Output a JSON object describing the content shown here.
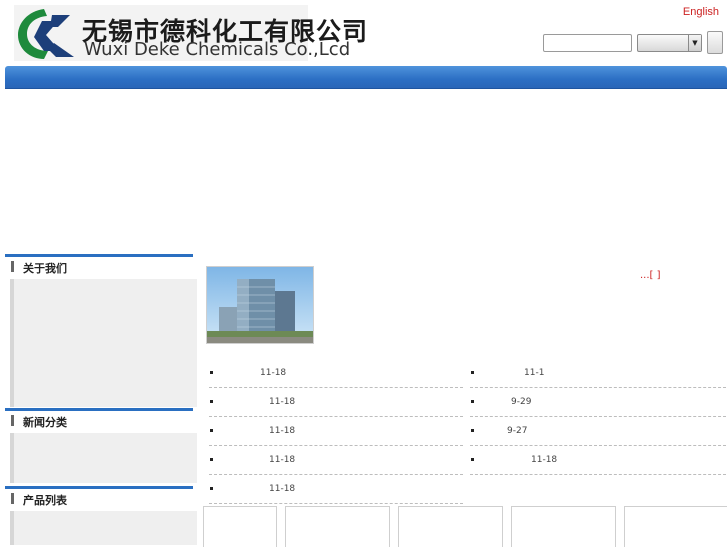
{
  "header": {
    "company_name_cn": "无锡市德科化工有限公司",
    "company_name_en": "Wuxi Deke Chemicals Co.,Lcd",
    "language_link": "English",
    "search": {
      "value": "",
      "placeholder": "",
      "select_value": ""
    },
    "logo_icon": "deke-logo-icon"
  },
  "sidebar": {
    "sections": [
      {
        "title": "关于我们"
      },
      {
        "title": "新闻分类"
      },
      {
        "title": "产品列表"
      }
    ]
  },
  "main": {
    "about": {
      "more_label": "...[   ]"
    },
    "news_left": [
      {
        "date": "11-18"
      },
      {
        "date": "11-18"
      },
      {
        "date": "11-18"
      },
      {
        "date": "11-18"
      },
      {
        "date": "11-18"
      }
    ],
    "news_right": [
      {
        "date": "11-1"
      },
      {
        "date": "9-29"
      },
      {
        "date": "9-27"
      },
      {
        "date": "11-18"
      }
    ]
  },
  "colors": {
    "accent_blue": "#2a6fc1",
    "link_red": "#cc2222",
    "logo_green": "#1e8a3c",
    "logo_navy": "#1d3f7a"
  }
}
